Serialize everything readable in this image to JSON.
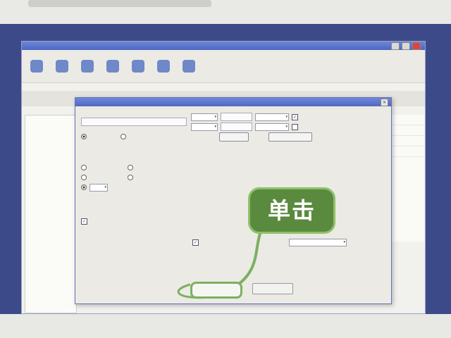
{
  "callout": {
    "text": "单击"
  },
  "colors": {
    "monitor": "#3d4a8a",
    "callout": "#5a8a3e",
    "callout_border": "#8ec06a"
  },
  "icons": [
    "save-icon",
    "search-icon",
    "globe-icon",
    "disk-icon",
    "leaf-icon",
    "trash-icon",
    "gear-icon",
    "close-icon"
  ]
}
